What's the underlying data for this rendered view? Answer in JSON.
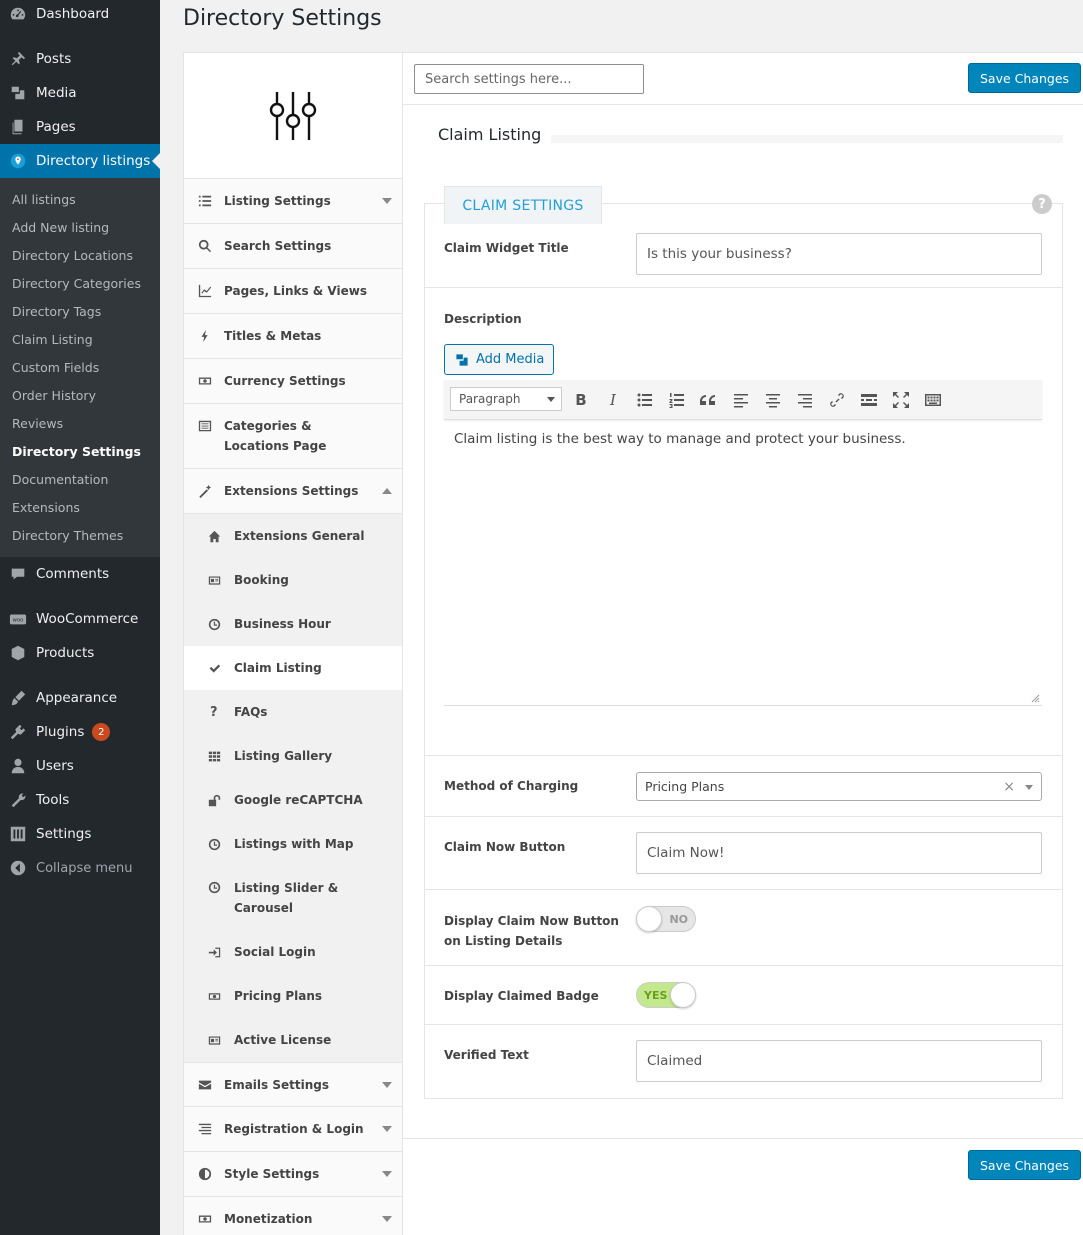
{
  "admin_menu": {
    "dashboard": "Dashboard",
    "posts": "Posts",
    "media": "Media",
    "pages": "Pages",
    "directory_listings": "Directory listings",
    "submenu": [
      "All listings",
      "Add New listing",
      "Directory Locations",
      "Directory Categories",
      "Directory Tags",
      "Claim Listing",
      "Custom Fields",
      "Order History",
      "Reviews",
      "Directory Settings",
      "Documentation",
      "Extensions",
      "Directory Themes"
    ],
    "comments": "Comments",
    "woocommerce": "WooCommerce",
    "products": "Products",
    "appearance": "Appearance",
    "plugins": "Plugins",
    "plugins_badge": "2",
    "users": "Users",
    "tools": "Tools",
    "settings": "Settings",
    "collapse": "Collapse menu"
  },
  "page": {
    "title": "Directory Settings"
  },
  "settings_nav": {
    "items": [
      {
        "label": "Listing Settings",
        "icon": "list-icon"
      },
      {
        "label": "Search Settings",
        "icon": "search-icon"
      },
      {
        "label": "Pages, Links & Views",
        "icon": "chart-icon"
      },
      {
        "label": "Titles & Metas",
        "icon": "bolt-icon"
      },
      {
        "label": "Currency Settings",
        "icon": "money-icon"
      },
      {
        "label": "Categories & Locations Page",
        "icon": "list-alt-icon"
      },
      {
        "label": "Extensions Settings",
        "icon": "wand-icon"
      }
    ],
    "extension_sub": [
      {
        "label": "Extensions General",
        "icon": "home-icon"
      },
      {
        "label": "Booking",
        "icon": "card-icon"
      },
      {
        "label": "Business Hour",
        "icon": "clock-icon"
      },
      {
        "label": "Claim Listing",
        "icon": "check-icon"
      },
      {
        "label": "FAQs",
        "icon": "question-icon"
      },
      {
        "label": "Listing Gallery",
        "icon": "grid-icon"
      },
      {
        "label": "Google reCAPTCHA",
        "icon": "unlock-icon"
      },
      {
        "label": "Listings with Map",
        "icon": "clock-icon"
      },
      {
        "label": "Listing Slider & Carousel",
        "icon": "clock-icon"
      },
      {
        "label": "Social Login",
        "icon": "sign-in-icon"
      },
      {
        "label": "Pricing Plans",
        "icon": "money-icon"
      },
      {
        "label": "Active License",
        "icon": "card-icon"
      }
    ],
    "bottom_items": [
      {
        "label": "Emails Settings",
        "icon": "envelope-icon"
      },
      {
        "label": "Registration & Login",
        "icon": "align-icon"
      },
      {
        "label": "Style Settings",
        "icon": "contrast-icon"
      },
      {
        "label": "Monetization",
        "icon": "money-icon"
      }
    ]
  },
  "topbar": {
    "search_placeholder": "Search settings here...",
    "save_label": "Save Changes"
  },
  "section": {
    "title": "Claim Listing",
    "tab": "CLAIM SETTINGS",
    "help": "?"
  },
  "fields": {
    "widget_title_label": "Claim Widget Title",
    "widget_title_value": "Is this your business?",
    "description_label": "Description",
    "add_media": "Add Media",
    "format": "Paragraph",
    "description_text": "Claim listing is the best way to manage and protect your business.",
    "method_label": "Method of Charging",
    "method_value": "Pricing Plans",
    "method_clear": "×",
    "claim_btn_label": "Claim Now Button",
    "claim_btn_value": "Claim Now!",
    "display_claim_label": "Display Claim Now Button on Listing Details",
    "display_claim_value": "NO",
    "badge_label": "Display Claimed Badge",
    "badge_value": "YES",
    "verified_label": "Verified Text",
    "verified_value": "Claimed"
  },
  "footer": {
    "save_label": "Save Changes"
  }
}
